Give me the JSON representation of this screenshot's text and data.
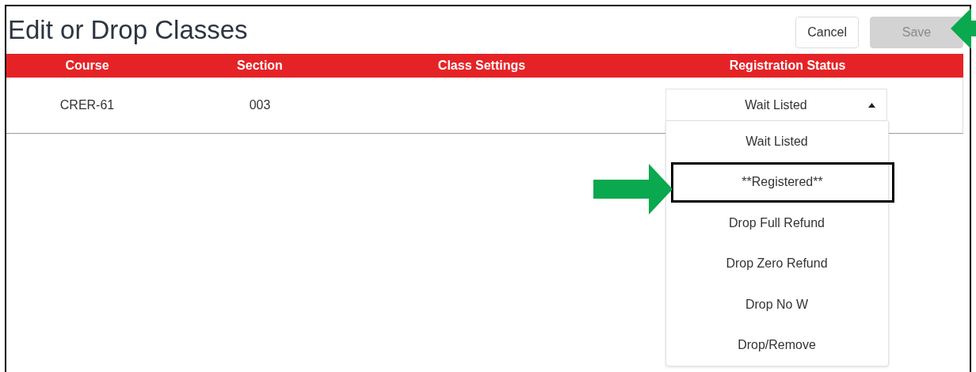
{
  "title": "Edit or Drop Classes",
  "buttons": [
    {
      "label": "Cancel",
      "disabled": false
    },
    {
      "label": "Save",
      "disabled": true
    }
  ],
  "table": {
    "columns": [
      "Course",
      "Section",
      "Class Settings",
      "Registration Status"
    ],
    "rows": [
      {
        "course": "CRER-61",
        "section": "003",
        "status": {
          "value": "Wait Listed",
          "expanded": true,
          "options": [
            {
              "label": "Wait Listed",
              "highlighted": false
            },
            {
              "label": "**Registered**",
              "highlighted": true
            },
            {
              "label": "Drop Full Refund",
              "highlighted": false
            },
            {
              "label": "Drop Zero Refund",
              "highlighted": false
            },
            {
              "label": "Drop No W",
              "highlighted": false
            },
            {
              "label": "Drop/Remove",
              "highlighted": false
            }
          ]
        }
      }
    ]
  }
}
